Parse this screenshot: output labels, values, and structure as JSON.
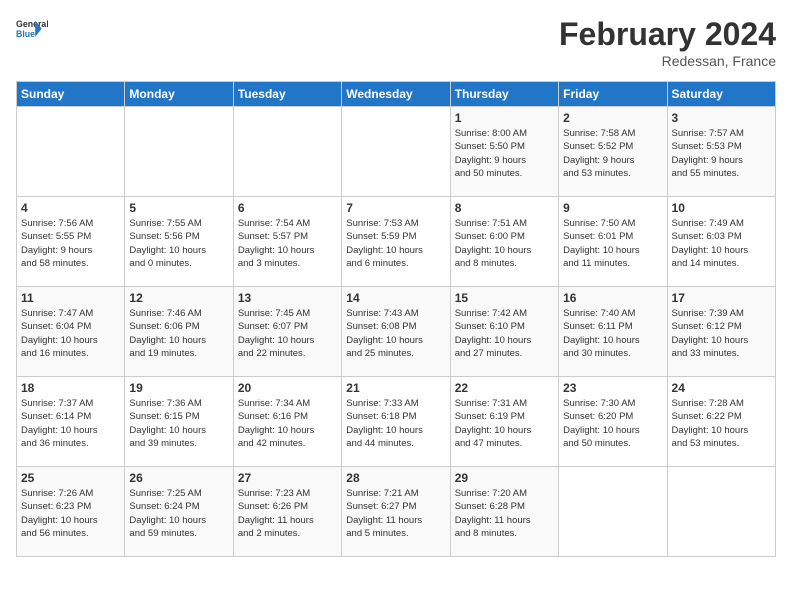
{
  "logo": {
    "line1": "General",
    "line2": "Blue"
  },
  "title": "February 2024",
  "subtitle": "Redessan, France",
  "days_of_week": [
    "Sunday",
    "Monday",
    "Tuesday",
    "Wednesday",
    "Thursday",
    "Friday",
    "Saturday"
  ],
  "weeks": [
    [
      {
        "day": "",
        "info": ""
      },
      {
        "day": "",
        "info": ""
      },
      {
        "day": "",
        "info": ""
      },
      {
        "day": "",
        "info": ""
      },
      {
        "day": "1",
        "info": "Sunrise: 8:00 AM\nSunset: 5:50 PM\nDaylight: 9 hours\nand 50 minutes."
      },
      {
        "day": "2",
        "info": "Sunrise: 7:58 AM\nSunset: 5:52 PM\nDaylight: 9 hours\nand 53 minutes."
      },
      {
        "day": "3",
        "info": "Sunrise: 7:57 AM\nSunset: 5:53 PM\nDaylight: 9 hours\nand 55 minutes."
      }
    ],
    [
      {
        "day": "4",
        "info": "Sunrise: 7:56 AM\nSunset: 5:55 PM\nDaylight: 9 hours\nand 58 minutes."
      },
      {
        "day": "5",
        "info": "Sunrise: 7:55 AM\nSunset: 5:56 PM\nDaylight: 10 hours\nand 0 minutes."
      },
      {
        "day": "6",
        "info": "Sunrise: 7:54 AM\nSunset: 5:57 PM\nDaylight: 10 hours\nand 3 minutes."
      },
      {
        "day": "7",
        "info": "Sunrise: 7:53 AM\nSunset: 5:59 PM\nDaylight: 10 hours\nand 6 minutes."
      },
      {
        "day": "8",
        "info": "Sunrise: 7:51 AM\nSunset: 6:00 PM\nDaylight: 10 hours\nand 8 minutes."
      },
      {
        "day": "9",
        "info": "Sunrise: 7:50 AM\nSunset: 6:01 PM\nDaylight: 10 hours\nand 11 minutes."
      },
      {
        "day": "10",
        "info": "Sunrise: 7:49 AM\nSunset: 6:03 PM\nDaylight: 10 hours\nand 14 minutes."
      }
    ],
    [
      {
        "day": "11",
        "info": "Sunrise: 7:47 AM\nSunset: 6:04 PM\nDaylight: 10 hours\nand 16 minutes."
      },
      {
        "day": "12",
        "info": "Sunrise: 7:46 AM\nSunset: 6:06 PM\nDaylight: 10 hours\nand 19 minutes."
      },
      {
        "day": "13",
        "info": "Sunrise: 7:45 AM\nSunset: 6:07 PM\nDaylight: 10 hours\nand 22 minutes."
      },
      {
        "day": "14",
        "info": "Sunrise: 7:43 AM\nSunset: 6:08 PM\nDaylight: 10 hours\nand 25 minutes."
      },
      {
        "day": "15",
        "info": "Sunrise: 7:42 AM\nSunset: 6:10 PM\nDaylight: 10 hours\nand 27 minutes."
      },
      {
        "day": "16",
        "info": "Sunrise: 7:40 AM\nSunset: 6:11 PM\nDaylight: 10 hours\nand 30 minutes."
      },
      {
        "day": "17",
        "info": "Sunrise: 7:39 AM\nSunset: 6:12 PM\nDaylight: 10 hours\nand 33 minutes."
      }
    ],
    [
      {
        "day": "18",
        "info": "Sunrise: 7:37 AM\nSunset: 6:14 PM\nDaylight: 10 hours\nand 36 minutes."
      },
      {
        "day": "19",
        "info": "Sunrise: 7:36 AM\nSunset: 6:15 PM\nDaylight: 10 hours\nand 39 minutes."
      },
      {
        "day": "20",
        "info": "Sunrise: 7:34 AM\nSunset: 6:16 PM\nDaylight: 10 hours\nand 42 minutes."
      },
      {
        "day": "21",
        "info": "Sunrise: 7:33 AM\nSunset: 6:18 PM\nDaylight: 10 hours\nand 44 minutes."
      },
      {
        "day": "22",
        "info": "Sunrise: 7:31 AM\nSunset: 6:19 PM\nDaylight: 10 hours\nand 47 minutes."
      },
      {
        "day": "23",
        "info": "Sunrise: 7:30 AM\nSunset: 6:20 PM\nDaylight: 10 hours\nand 50 minutes."
      },
      {
        "day": "24",
        "info": "Sunrise: 7:28 AM\nSunset: 6:22 PM\nDaylight: 10 hours\nand 53 minutes."
      }
    ],
    [
      {
        "day": "25",
        "info": "Sunrise: 7:26 AM\nSunset: 6:23 PM\nDaylight: 10 hours\nand 56 minutes."
      },
      {
        "day": "26",
        "info": "Sunrise: 7:25 AM\nSunset: 6:24 PM\nDaylight: 10 hours\nand 59 minutes."
      },
      {
        "day": "27",
        "info": "Sunrise: 7:23 AM\nSunset: 6:26 PM\nDaylight: 11 hours\nand 2 minutes."
      },
      {
        "day": "28",
        "info": "Sunrise: 7:21 AM\nSunset: 6:27 PM\nDaylight: 11 hours\nand 5 minutes."
      },
      {
        "day": "29",
        "info": "Sunrise: 7:20 AM\nSunset: 6:28 PM\nDaylight: 11 hours\nand 8 minutes."
      },
      {
        "day": "",
        "info": ""
      },
      {
        "day": "",
        "info": ""
      }
    ]
  ]
}
